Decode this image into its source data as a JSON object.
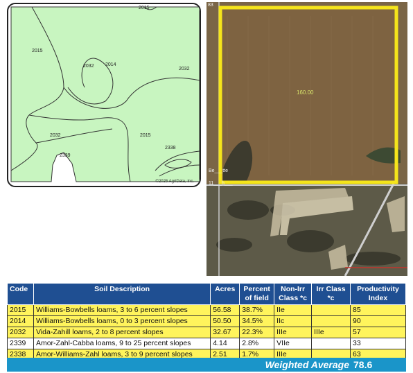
{
  "soil_map": {
    "copyright": "©2025 AgriData, Inc.",
    "labels": {
      "top_2015": "2015",
      "left_2015": "2015",
      "mid_2032": "2032",
      "mid_2014": "2014",
      "right_2032": "2032",
      "lower_2032": "2032",
      "lower_2015": "2015",
      "lower_2339": "2339",
      "lower_2338": "2338"
    }
  },
  "aerial": {
    "field_acres": "160.00",
    "top_left_text": "83",
    "left_text": "Be___tte",
    "left_text2": "11___h___"
  },
  "table": {
    "headers": [
      "Code",
      "Soil Description",
      "Acres",
      "Percent of field",
      "Non-Irr Class *c",
      "Irr Class *c",
      "Productivity Index"
    ],
    "rows": [
      {
        "code": "2015",
        "description": "Williams-Bowbells loams, 3 to 6 percent slopes",
        "acres": "56.58",
        "percent": "38.7%",
        "nonirr": "IIe",
        "irr": "",
        "pi": "85",
        "highlight": true
      },
      {
        "code": "2014",
        "description": "Williams-Bowbells loams, 0 to 3 percent slopes",
        "acres": "50.50",
        "percent": "34.5%",
        "nonirr": "IIc",
        "irr": "",
        "pi": "90",
        "highlight": true
      },
      {
        "code": "2032",
        "description": "Vida-Zahill loams, 2 to 8 percent slopes",
        "acres": "32.67",
        "percent": "22.3%",
        "nonirr": "IIIe",
        "irr": "IIIe",
        "pi": "57",
        "highlight": true
      },
      {
        "code": "2339",
        "description": "Amor-Zahl-Cabba loams, 9 to 25 percent slopes",
        "acres": "4.14",
        "percent": "2.8%",
        "nonirr": "VIIe",
        "irr": "",
        "pi": "33",
        "highlight": false
      },
      {
        "code": "2338",
        "description": "Amor-Williams-Zahl loams, 3 to 9 percent slopes",
        "acres": "2.51",
        "percent": "1.7%",
        "nonirr": "IIIe",
        "irr": "",
        "pi": "63",
        "highlight": true
      }
    ]
  },
  "weighted_average": {
    "label": "Weighted Average",
    "value": "78.6"
  },
  "colors": {
    "map_green": "#c8f5c0",
    "header_blue": "#1f4f92",
    "highlight_yellow": "#fff45c",
    "footer_blue": "#1a95c9",
    "boundary_yellow": "#f5e51b"
  }
}
